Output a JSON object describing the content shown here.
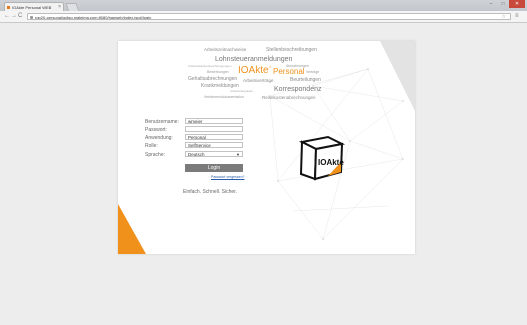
{
  "browser": {
    "tab_title": "IOAkte Personal WEB",
    "tab_close": "×",
    "url": "rqp20-personal/qdisq.maleima.com:8080/hqpweb/index.jsp#/login",
    "window_min": "–",
    "window_max": "□",
    "window_close": "✕",
    "back": "←",
    "forward": "→",
    "reload": "C",
    "star": "☆",
    "menu": "≡"
  },
  "cloud": {
    "words": [
      "Arbeitszeitnachweise",
      "Stellenbeschreibungen",
      "Lohnsteueranmeldungen",
      "Abmahnungen",
      "Krankenkassenbescheinigungen",
      "Bewerbungen",
      "IOAkte",
      "®",
      "Personal",
      "Verträge",
      "Gehaltsabrechnungen",
      "Arbeitsverträge",
      "Beurteilungen",
      "Krankmeldungen",
      "Arbeitszeugnisse",
      "Korrespondenz",
      "Verfahrensdokumentation",
      "Reisekostenabrechnungen"
    ]
  },
  "form": {
    "username_label": "Benutzername:",
    "username_value": "wmeier",
    "password_label": "Passwort:",
    "password_value": "",
    "application_label": "Anwendung:",
    "application_value": "Personal",
    "role_label": "Rolle:",
    "role_value": "SelfService",
    "language_label": "Sprache:",
    "language_value": "Deutsch",
    "login_label": "Login",
    "forgot_link": "Passwort vergessen?"
  },
  "slogan": "Einfach. Schnell. Sicher.",
  "logo": {
    "text": "IOAkte"
  },
  "colors": {
    "accent": "#f0911c",
    "button": "#7b7b7b",
    "link": "#2a5ca8",
    "close": "#c9483c"
  },
  "icons": [
    "favicon-icon",
    "lock-icon",
    "star-icon",
    "menu-icon",
    "ioakte-logo-icon"
  ]
}
